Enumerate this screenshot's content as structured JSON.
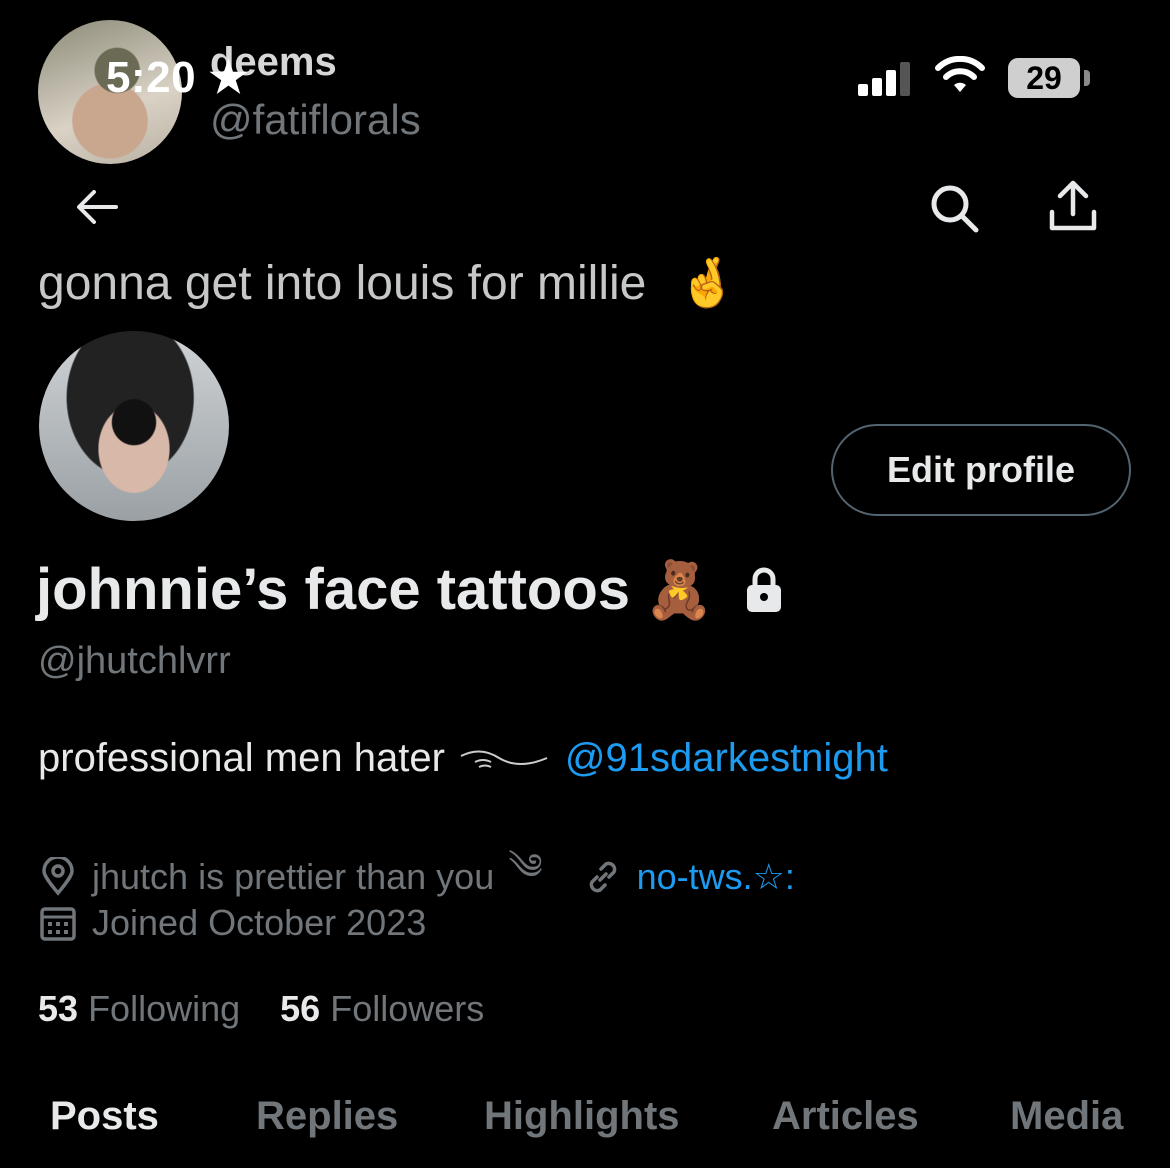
{
  "status_bar": {
    "time": "5:20",
    "battery": "29"
  },
  "quoted": {
    "name": "deems",
    "handle": "@fatiflorals",
    "text": "gonna get into louis for millie",
    "emoji": "🤞"
  },
  "profile": {
    "edit_label": "Edit profile",
    "display_name": "johnnie’s face tattoos",
    "name_emoji": "🧸",
    "handle": "@jhutchlvrr",
    "bio_text": "professional men hater",
    "bio_link": "@91sdarkestnight",
    "location": "jhutch is prettier than you",
    "location_emoji": "༄",
    "website": "no-tws.☆:",
    "joined": "Joined October 2023",
    "following_count": "53",
    "following_label": "Following",
    "followers_count": "56",
    "followers_label": "Followers"
  },
  "tabs": [
    "Posts",
    "Replies",
    "Highlights",
    "Articles",
    "Media"
  ],
  "colors": {
    "accent": "#1d9bf0",
    "muted": "#71767b",
    "text": "#e7e9ea",
    "background": "#000000"
  },
  "icons": [
    "back-arrow-icon",
    "search-icon",
    "share-icon",
    "lock-icon",
    "location-pin-icon",
    "link-icon",
    "calendar-icon",
    "star-icon"
  ]
}
